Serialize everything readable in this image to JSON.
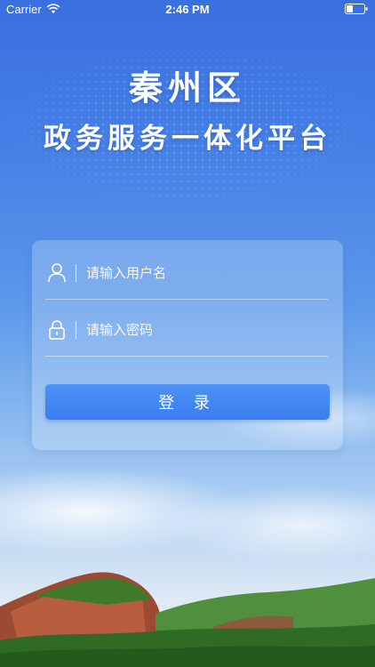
{
  "status_bar": {
    "carrier": "Carrier",
    "time": "2:46 PM",
    "icons": [
      "wifi-icon",
      "battery-icon"
    ]
  },
  "header": {
    "title": "秦州区",
    "subtitle": "政务服务一体化平台"
  },
  "login_form": {
    "username": {
      "value": "",
      "placeholder": "请输入用户名",
      "icon": "user-icon"
    },
    "password": {
      "value": "",
      "placeholder": "请输入密码",
      "icon": "lock-icon"
    },
    "submit_label": "登 录"
  },
  "colors": {
    "primary": "#3f84f2",
    "sky_top": "#3a6fe0",
    "text_on_primary": "#ffffff"
  }
}
